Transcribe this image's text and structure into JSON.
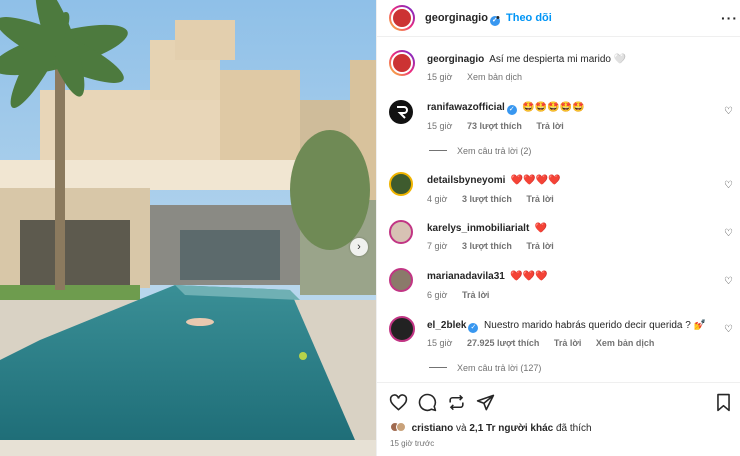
{
  "header": {
    "username": "georginagio",
    "separator": "•",
    "follow_label": "Theo dõi",
    "more_label": "···"
  },
  "caption": {
    "username": "georginagio",
    "text": "Así me despierta mi marido 🤍",
    "time": "15 giờ",
    "translate": "Xem bản dịch"
  },
  "comments": [
    {
      "username": "ranifawazofficial",
      "verified": true,
      "text": "🤩🤩🤩🤩🤩",
      "time": "15 giờ",
      "likes": "73 lượt thích",
      "reply": "Trả lời",
      "view_replies": "Xem câu trả lời (2)"
    },
    {
      "username": "detailsbyneyomi",
      "text": "❤️❤️❤️❤️",
      "time": "4 giờ",
      "likes": "3 lượt thích",
      "reply": "Trả lời"
    },
    {
      "username": "karelys_inmobiliarialt",
      "text": "❤️",
      "time": "7 giờ",
      "likes": "3 lượt thích",
      "reply": "Trả lời"
    },
    {
      "username": "marianadavila31",
      "text": "❤️❤️❤️",
      "time": "6 giờ",
      "reply": "Trả lời"
    },
    {
      "username": "el_2blek",
      "verified": true,
      "text": "Nuestro marido habrás querido decir querida ? 💅",
      "time": "15 giờ",
      "likes": "27.925 lượt thích",
      "reply": "Trả lời",
      "translate": "Xem bản dịch",
      "view_replies": "Xem câu trả lời (127)"
    }
  ],
  "likes_summary": {
    "user": "cristiano",
    "middle": " và ",
    "count": "2,1 Tr người khác",
    "suffix": " đã thích"
  },
  "time_ago": "15 giờ trước",
  "icons": [
    "heart-icon",
    "comment-icon",
    "repost-icon",
    "share-icon",
    "bookmark-icon",
    "chevron-right-icon",
    "verified-icon",
    "more-icon"
  ],
  "colors": {
    "accent": "#0095f6",
    "verified": "#3897f0",
    "heart": "#e0245e"
  }
}
